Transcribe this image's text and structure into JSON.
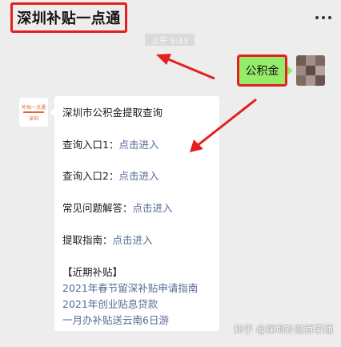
{
  "header": {
    "title": "深圳补贴一点通",
    "more_icon": "more-dots-icon"
  },
  "chat": {
    "timestamp": "上午 9:33",
    "user_message": "公积金",
    "bot_avatar_text_top": "补贴一点通",
    "bot_avatar_text_bottom": "深圳",
    "bot": {
      "title": "深圳市公积金提取查询",
      "entry1_label": "查询入口1：",
      "entry1_link": "点击进入",
      "entry2_label": "查询入口2：",
      "entry2_link": "点击进入",
      "faq_label": "常见问题解答：",
      "faq_link": "点击进入",
      "guide_label": "提取指南：",
      "guide_link": "点击进入",
      "recent_heading": "【近期补贴】",
      "recent_links": [
        "2021年春节留深补贴申请指南",
        "2021年创业贴息贷款",
        "一月办补贴送云南6日游"
      ]
    }
  },
  "watermark": "知乎 @深圳补贴百事通",
  "colors": {
    "annotation_red": "#e32020",
    "user_bubble_green": "#95ec69",
    "link_blue": "#576b95",
    "background": "#ededed"
  }
}
